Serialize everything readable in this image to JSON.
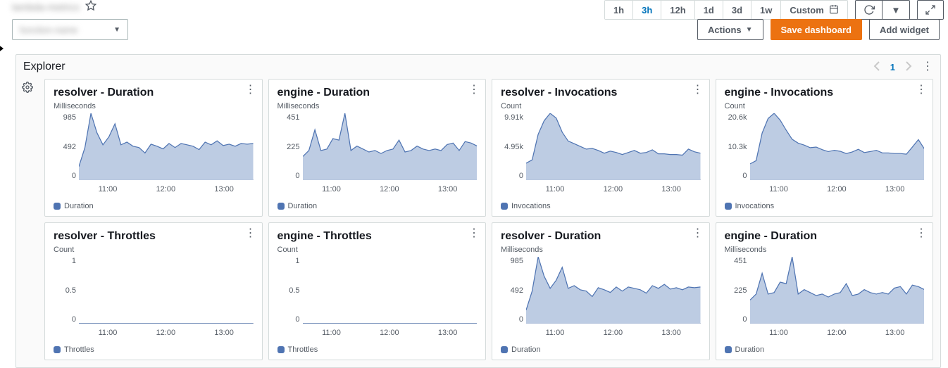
{
  "header": {
    "dashboard_name": "lambda-metrics",
    "range_options": [
      "1h",
      "3h",
      "12h",
      "1d",
      "3d",
      "1w",
      "Custom"
    ],
    "active_range": "3h",
    "dropdown_label": "function-name",
    "actions_label": "Actions",
    "save_label": "Save dashboard",
    "add_widget_label": "Add widget"
  },
  "explorer": {
    "title": "Explorer",
    "page": "1"
  },
  "colors": {
    "series_stroke": "#4f74b2",
    "series_fill": "#b6c7e0"
  },
  "chart_data": [
    {
      "title": "resolver - Duration",
      "unit": "Milliseconds",
      "legend": "Duration",
      "y_ticks": [
        "985",
        "492",
        "0"
      ],
      "ymax": 985,
      "x_ticks": [
        "11:00",
        "12:00",
        "13:00"
      ],
      "type": "area",
      "values": [
        200,
        480,
        985,
        700,
        520,
        640,
        830,
        520,
        560,
        500,
        480,
        400,
        530,
        500,
        460,
        540,
        480,
        540,
        520,
        500,
        450,
        560,
        520,
        580,
        510,
        530,
        500,
        540,
        530,
        540
      ]
    },
    {
      "title": "engine - Duration",
      "unit": "Milliseconds",
      "legend": "Duration",
      "y_ticks": [
        "451",
        "225",
        "0"
      ],
      "ymax": 451,
      "x_ticks": [
        "11:00",
        "12:00",
        "13:00"
      ],
      "type": "area",
      "values": [
        160,
        200,
        340,
        200,
        210,
        280,
        270,
        451,
        200,
        230,
        210,
        190,
        200,
        180,
        200,
        210,
        270,
        190,
        200,
        230,
        210,
        200,
        210,
        200,
        240,
        250,
        200,
        260,
        250,
        230
      ]
    },
    {
      "title": "resolver - Invocations",
      "unit": "Count",
      "legend": "Invocations",
      "y_ticks": [
        "9.91k",
        "4.95k",
        "0"
      ],
      "ymax": 9910,
      "x_ticks": [
        "11:00",
        "12:00",
        "13:00"
      ],
      "type": "area",
      "values": [
        2500,
        3000,
        6800,
        8800,
        9910,
        9200,
        7100,
        5800,
        5400,
        5000,
        4600,
        4700,
        4400,
        4000,
        4300,
        4100,
        3800,
        4100,
        4400,
        4000,
        4100,
        4500,
        3900,
        3900,
        3800,
        3800,
        3700,
        4600,
        4200,
        4000
      ]
    },
    {
      "title": "engine - Invocations",
      "unit": "Count",
      "legend": "Invocations",
      "y_ticks": [
        "20.6k",
        "10.3k",
        "0"
      ],
      "ymax": 20600,
      "x_ticks": [
        "11:00",
        "12:00",
        "13:00"
      ],
      "type": "area",
      "values": [
        5000,
        6000,
        14500,
        19000,
        20600,
        18500,
        15400,
        12600,
        11400,
        10800,
        10000,
        10200,
        9400,
        8800,
        9200,
        8900,
        8200,
        8700,
        9500,
        8500,
        8800,
        9200,
        8400,
        8400,
        8200,
        8200,
        8000,
        10200,
        12500,
        9600
      ]
    },
    {
      "title": "resolver - Throttles",
      "unit": "Count",
      "legend": "Throttles",
      "y_ticks": [
        "1",
        "0.5",
        "0"
      ],
      "ymax": 1,
      "x_ticks": [
        "11:00",
        "12:00",
        "13:00"
      ],
      "type": "area",
      "values": [
        0,
        0,
        0,
        0,
        0,
        0,
        0,
        0,
        0,
        0,
        0,
        0,
        0,
        0,
        0,
        0,
        0,
        0,
        0,
        0,
        0,
        0,
        0,
        0,
        0,
        0,
        0,
        0,
        0,
        0
      ]
    },
    {
      "title": "engine - Throttles",
      "unit": "Count",
      "legend": "Throttles",
      "y_ticks": [
        "1",
        "0.5",
        "0"
      ],
      "ymax": 1,
      "x_ticks": [
        "11:00",
        "12:00",
        "13:00"
      ],
      "type": "area",
      "values": [
        0,
        0,
        0,
        0,
        0,
        0,
        0,
        0,
        0,
        0,
        0,
        0,
        0,
        0,
        0,
        0,
        0,
        0,
        0,
        0,
        0,
        0,
        0,
        0,
        0,
        0,
        0,
        0,
        0,
        0
      ]
    },
    {
      "title": "resolver - Duration",
      "unit": "Milliseconds",
      "legend": "Duration",
      "y_ticks": [
        "985",
        "492",
        "0"
      ],
      "ymax": 985,
      "x_ticks": [
        "11:00",
        "12:00",
        "13:00"
      ],
      "type": "area",
      "values": [
        200,
        480,
        985,
        700,
        520,
        640,
        830,
        520,
        560,
        500,
        480,
        400,
        530,
        500,
        460,
        540,
        480,
        540,
        520,
        500,
        450,
        560,
        520,
        580,
        510,
        530,
        500,
        540,
        530,
        540
      ]
    },
    {
      "title": "engine - Duration",
      "unit": "Milliseconds",
      "legend": "Duration",
      "y_ticks": [
        "451",
        "225",
        "0"
      ],
      "ymax": 451,
      "x_ticks": [
        "11:00",
        "12:00",
        "13:00"
      ],
      "type": "area",
      "values": [
        160,
        200,
        340,
        200,
        210,
        280,
        270,
        451,
        200,
        230,
        210,
        190,
        200,
        180,
        200,
        210,
        270,
        190,
        200,
        230,
        210,
        200,
        210,
        200,
        240,
        250,
        200,
        260,
        250,
        230
      ]
    }
  ]
}
